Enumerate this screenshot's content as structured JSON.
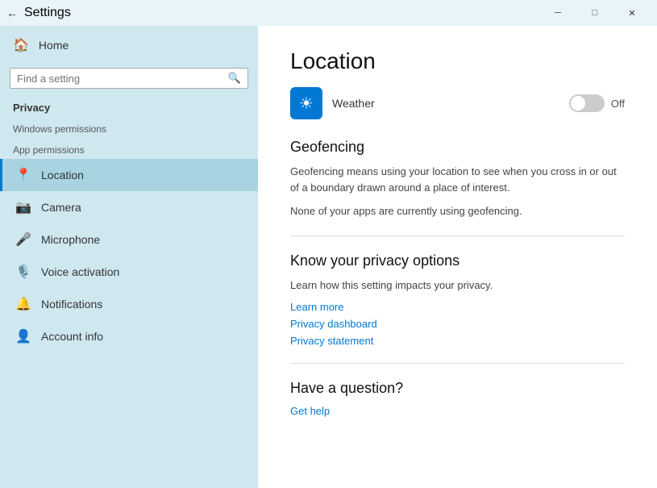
{
  "titleBar": {
    "title": "Settings",
    "backLabel": "←",
    "minimizeLabel": "─",
    "maximizeLabel": "□",
    "closeLabel": "✕"
  },
  "sidebar": {
    "homeLabel": "Home",
    "searchPlaceholder": "Find a setting",
    "privacyLabel": "Privacy",
    "windowsPermissionsLabel": "Windows permissions",
    "appPermissionsLabel": "App permissions",
    "items": [
      {
        "id": "location",
        "label": "Location",
        "icon": "📍",
        "active": true
      },
      {
        "id": "camera",
        "label": "Camera",
        "icon": "📷",
        "active": false
      },
      {
        "id": "microphone",
        "label": "Microphone",
        "icon": "🎤",
        "active": false
      },
      {
        "id": "voice",
        "label": "Voice activation",
        "icon": "🎙️",
        "active": false
      },
      {
        "id": "notifications",
        "label": "Notifications",
        "icon": "🔔",
        "active": false
      },
      {
        "id": "account",
        "label": "Account info",
        "icon": "👤",
        "active": false
      }
    ]
  },
  "content": {
    "title": "Location",
    "appName": "Weather",
    "appIcon": "☀",
    "toggleState": "Off",
    "sections": [
      {
        "id": "geofencing",
        "title": "Geofencing",
        "text": "Geofencing means using your location to see when you cross in or out of a boundary drawn around a place of interest.",
        "statusText": "None of your apps are currently using geofencing."
      },
      {
        "id": "privacy",
        "title": "Know your privacy options",
        "text": "Learn how this setting impacts your privacy.",
        "links": [
          {
            "id": "learn-more",
            "label": "Learn more"
          },
          {
            "id": "privacy-dashboard",
            "label": "Privacy dashboard"
          },
          {
            "id": "privacy-statement",
            "label": "Privacy statement"
          }
        ]
      },
      {
        "id": "question",
        "title": "Have a question?",
        "links": [
          {
            "id": "get-help",
            "label": "Get help"
          }
        ]
      }
    ]
  }
}
